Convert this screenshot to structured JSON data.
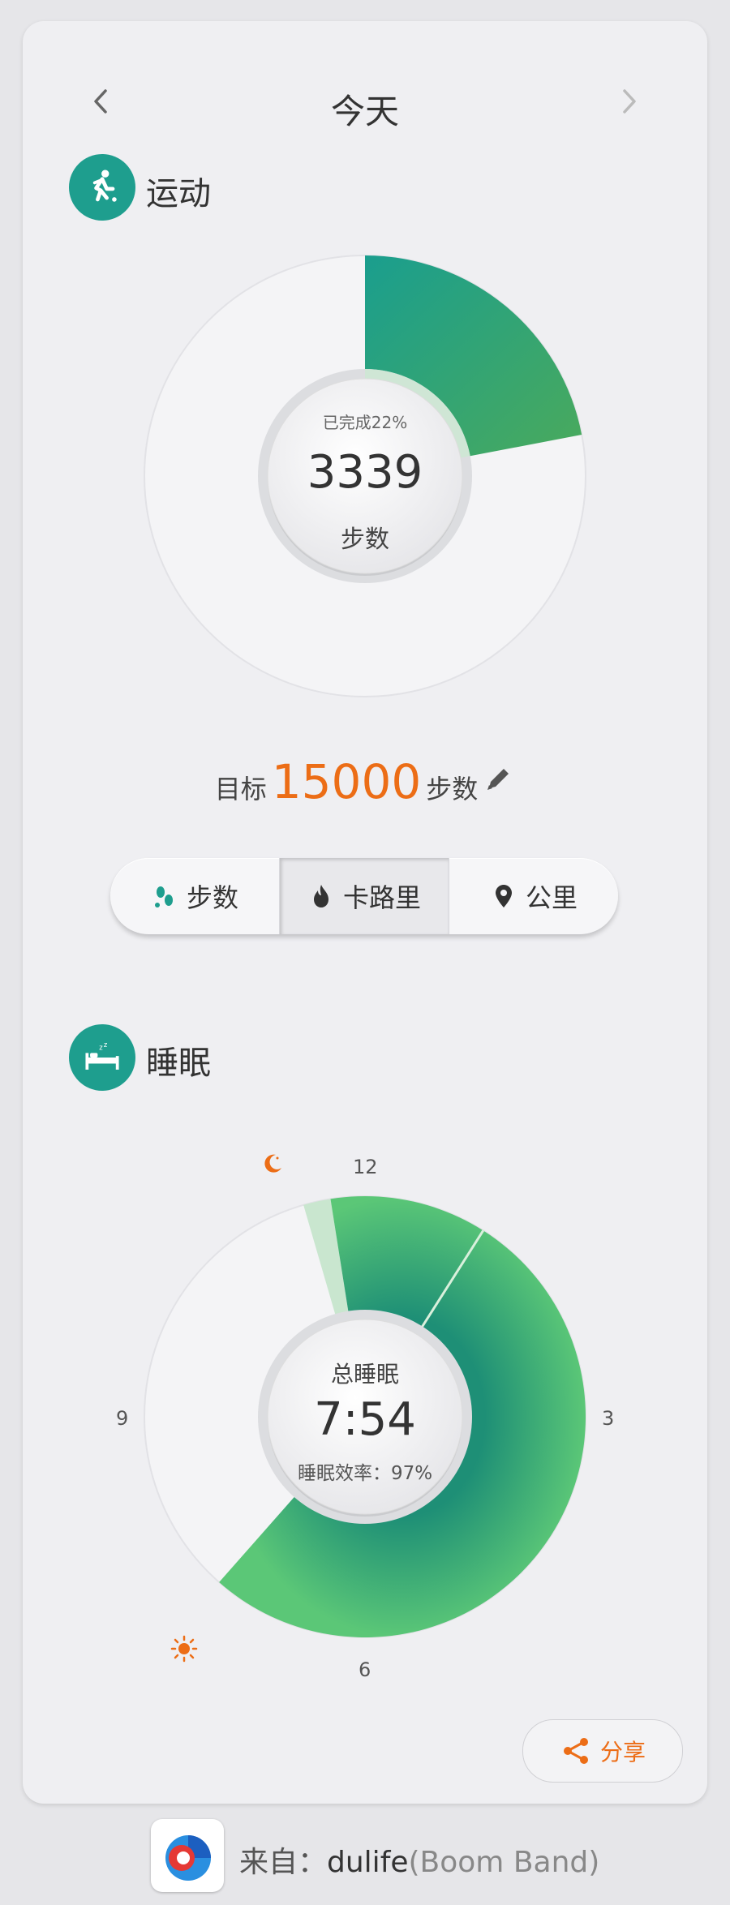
{
  "header": {
    "title": "今天"
  },
  "activity": {
    "title": "运动",
    "completion_text": "已完成22%",
    "completion_fraction": 0.22,
    "steps": "3339",
    "steps_unit": "步数",
    "goal_label": "目标",
    "goal_value": "15000",
    "goal_unit": "步数",
    "tabs": [
      "步数",
      "卡路里",
      "公里"
    ],
    "active_tab": 1
  },
  "sleep": {
    "title": "睡眠",
    "center_label": "总睡眠",
    "total": "7:54",
    "efficiency": "睡眠效率：97%",
    "clock_labels": {
      "top": "12",
      "right": "3",
      "bottom": "6",
      "left": "9"
    },
    "colors": {
      "deep": "#1e8f76",
      "light": "#5bc777",
      "awake": "#c9e6cf",
      "icon": "#ec6d16"
    }
  },
  "share": {
    "label": "分享"
  },
  "footer": {
    "prefix": "来自：",
    "app_name": "dulife",
    "developer": "(Boom Band)"
  },
  "colors": {
    "accent": "#1e9e8e",
    "orange": "#ec6d16"
  },
  "icons": {
    "prev": "chevron-left-icon",
    "next": "chevron-right-icon",
    "activity": "running-person-icon",
    "sleep": "bed-icon",
    "edit": "pencil-icon",
    "steps": "footprints-icon",
    "calories": "flame-icon",
    "distance": "location-pin-icon",
    "moon": "moon-icon",
    "sun": "sun-icon",
    "share": "share-icon",
    "app": "app-logo"
  }
}
